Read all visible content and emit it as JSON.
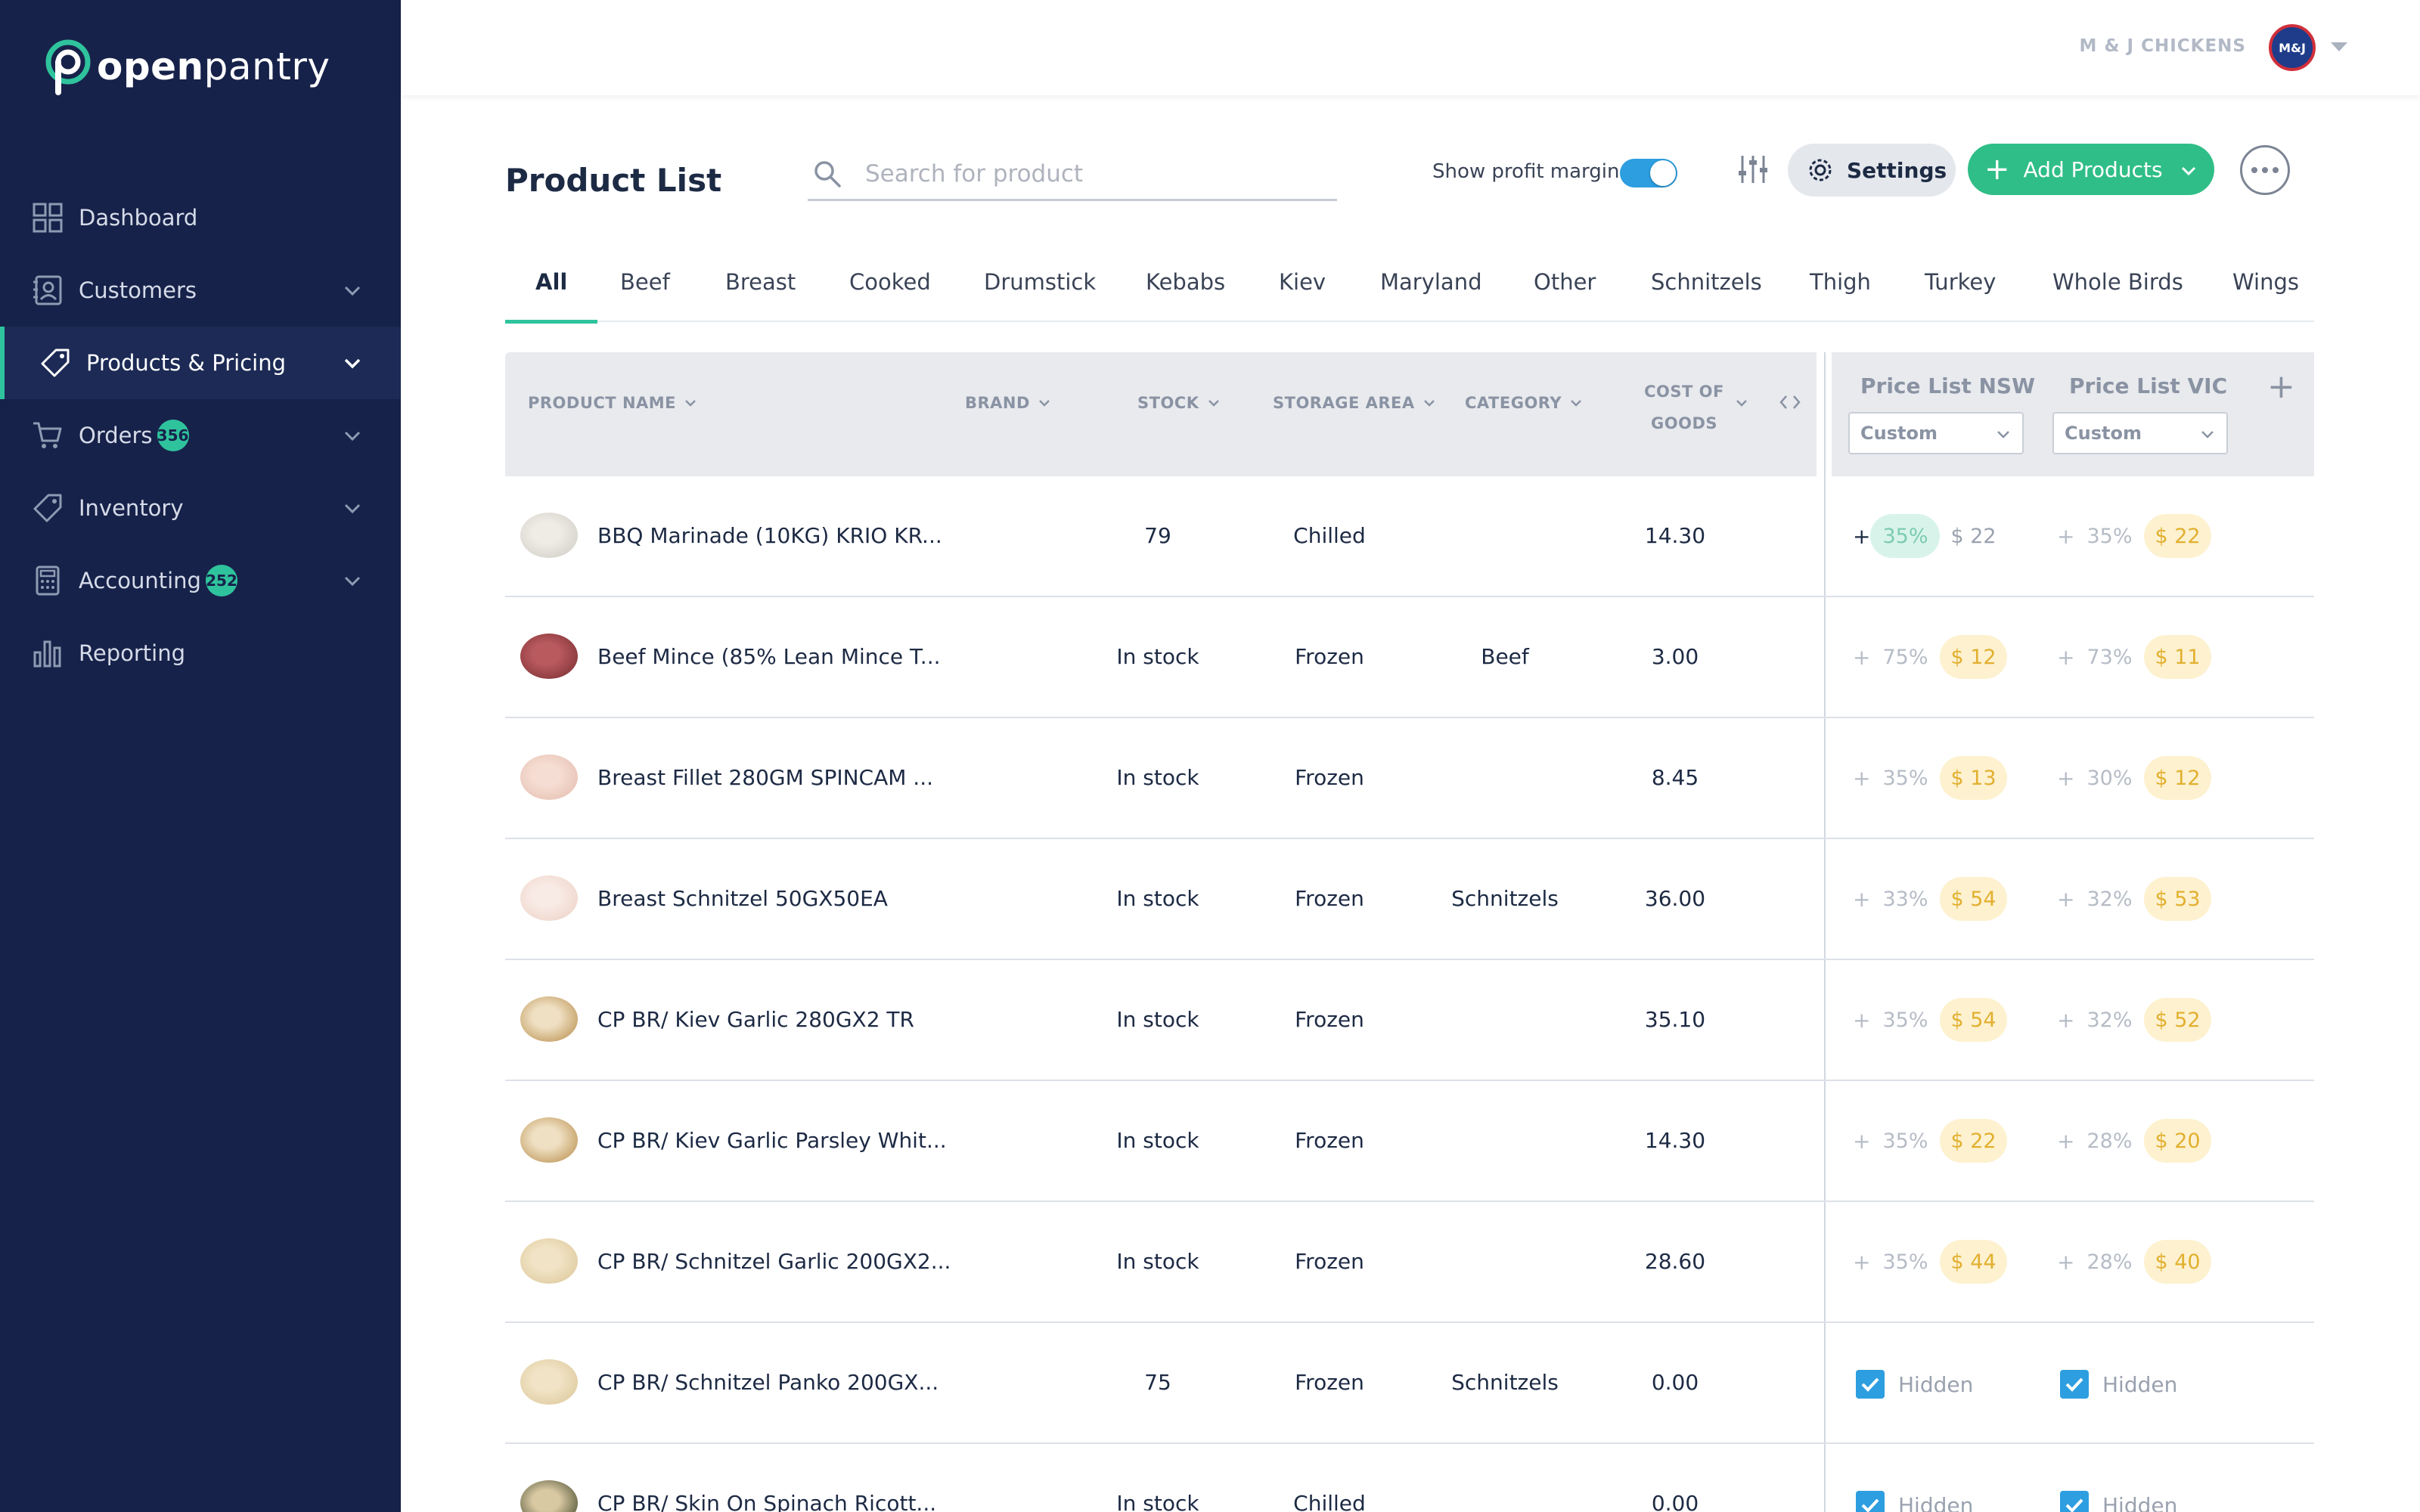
{
  "brand": {
    "name_bold": "open",
    "name_light": "pantry"
  },
  "nav": [
    {
      "label": "Dashboard",
      "icon": "dashboard-icon"
    },
    {
      "label": "Customers",
      "icon": "customers-icon",
      "chevron": true
    },
    {
      "label": "Products & Pricing",
      "icon": "tag-icon",
      "chevron": true,
      "active": true
    },
    {
      "label": "Orders",
      "icon": "cart-icon",
      "chevron": true,
      "badge": "356"
    },
    {
      "label": "Inventory",
      "icon": "tag-icon",
      "chevron": true
    },
    {
      "label": "Accounting",
      "icon": "calculator-icon",
      "chevron": true,
      "badge": "252"
    },
    {
      "label": "Reporting",
      "icon": "bar-chart-icon"
    }
  ],
  "topbar": {
    "company": "M & J CHICKENS",
    "avatar_text": "M&J"
  },
  "header": {
    "title": "Product List",
    "search_placeholder": "Search for product",
    "margin_label": "Show profit margin",
    "settings_label": "Settings",
    "add_label": "Add Products"
  },
  "tabs": [
    "All",
    "Beef",
    "Breast",
    "Cooked",
    "Drumstick",
    "Kebabs",
    "Kiev",
    "Maryland",
    "Other",
    "Schnitzels",
    "Thigh",
    "Turkey",
    "Whole Birds",
    "Wings"
  ],
  "columns": {
    "product_name": "PRODUCT NAME",
    "brand": "BRAND",
    "stock": "STOCK",
    "storage_area": "STORAGE AREA",
    "category": "CATEGORY",
    "cost_line1": "COST OF",
    "cost_line2": "GOODS"
  },
  "price_lists": [
    {
      "name": "Price List NSW",
      "mode": "Custom"
    },
    {
      "name": "Price List VIC",
      "mode": "Custom"
    }
  ],
  "rows": [
    {
      "name": "BBQ Marinade (10KG) KRIO KR...",
      "stock": "79",
      "storage": "Chilled",
      "category": "",
      "cost": "14.30",
      "nsw": {
        "pct": "35%",
        "price": "$ 22",
        "style": "green"
      },
      "vic": {
        "pct": "35%",
        "price": "$ 22",
        "style": "yellow"
      }
    },
    {
      "name": "Beef Mince (85% Lean Mince T...",
      "stock": "In stock",
      "storage": "Frozen",
      "category": "Beef",
      "cost": "3.00",
      "nsw": {
        "pct": "75%",
        "price": "$ 12",
        "style": "yellow"
      },
      "vic": {
        "pct": "73%",
        "price": "$ 11",
        "style": "yellow"
      }
    },
    {
      "name": "Breast Fillet 280GM SPINCAM ...",
      "stock": "In stock",
      "storage": "Frozen",
      "category": "",
      "cost": "8.45",
      "nsw": {
        "pct": "35%",
        "price": "$ 13",
        "style": "yellow"
      },
      "vic": {
        "pct": "30%",
        "price": "$ 12",
        "style": "yellow"
      }
    },
    {
      "name": "Breast Schnitzel 50GX50EA",
      "stock": "In stock",
      "storage": "Frozen",
      "category": "Schnitzels",
      "cost": "36.00",
      "nsw": {
        "pct": "33%",
        "price": "$ 54",
        "style": "yellow"
      },
      "vic": {
        "pct": "32%",
        "price": "$ 53",
        "style": "yellow"
      }
    },
    {
      "name": "CP BR/ Kiev Garlic 280GX2 TR",
      "stock": "In stock",
      "storage": "Frozen",
      "category": "",
      "cost": "35.10",
      "nsw": {
        "pct": "35%",
        "price": "$ 54",
        "style": "yellow"
      },
      "vic": {
        "pct": "32%",
        "price": "$ 52",
        "style": "yellow"
      }
    },
    {
      "name": "CP BR/ Kiev Garlic Parsley Whit...",
      "stock": "In stock",
      "storage": "Frozen",
      "category": "",
      "cost": "14.30",
      "nsw": {
        "pct": "35%",
        "price": "$ 22",
        "style": "yellow"
      },
      "vic": {
        "pct": "28%",
        "price": "$ 20",
        "style": "yellow"
      }
    },
    {
      "name": "CP BR/ Schnitzel Garlic 200GX2...",
      "stock": "In stock",
      "storage": "Frozen",
      "category": "",
      "cost": "28.60",
      "nsw": {
        "pct": "35%",
        "price": "$ 44",
        "style": "yellow"
      },
      "vic": {
        "pct": "28%",
        "price": "$ 40",
        "style": "yellow"
      }
    },
    {
      "name": "CP BR/ Schnitzel Panko 200GX...",
      "stock": "75",
      "storage": "Frozen",
      "category": "Schnitzels",
      "cost": "0.00",
      "nsw": {
        "hidden": "Hidden"
      },
      "vic": {
        "hidden": "Hidden"
      }
    },
    {
      "name": "CP BR/ Skin On Spinach Ricott...",
      "stock": "In stock",
      "storage": "Chilled",
      "category": "",
      "cost": "0.00",
      "nsw": {
        "hidden": "Hidden"
      },
      "vic": {
        "hidden": "Hidden"
      }
    }
  ],
  "colors": {
    "sidebar": "#17224a",
    "accent": "#2fc39d",
    "add_button": "#2fbe87",
    "toggle": "#2d9ee0"
  }
}
